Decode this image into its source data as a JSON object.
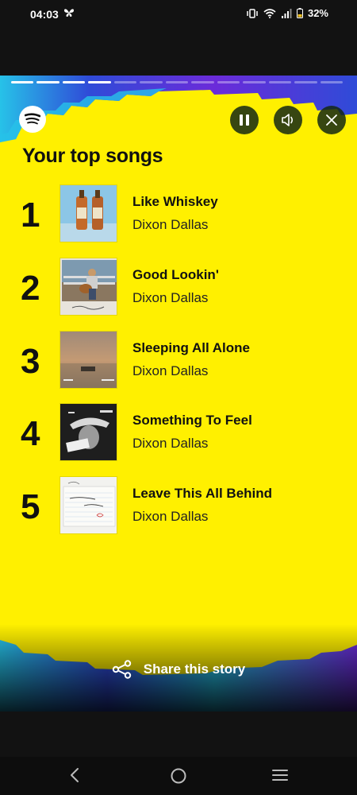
{
  "status_bar": {
    "time": "04:03",
    "battery": "32%"
  },
  "story": {
    "progress_total": 13,
    "progress_done": 4,
    "title": "Your top songs",
    "share_label": "Share this story",
    "colors": {
      "background": "#fff000",
      "accent_blue": "#2f4bd8",
      "accent_purple": "#6b2bd9",
      "accent_cyan": "#27c2e8"
    }
  },
  "controls": {
    "pause_icon": "pause-icon",
    "sound_icon": "speaker-icon",
    "close_icon": "close-icon"
  },
  "songs": [
    {
      "rank": "1",
      "title": "Like Whiskey",
      "artist": "Dixon Dallas"
    },
    {
      "rank": "2",
      "title": "Good Lookin'",
      "artist": "Dixon Dallas"
    },
    {
      "rank": "3",
      "title": "Sleeping All Alone",
      "artist": "Dixon Dallas"
    },
    {
      "rank": "4",
      "title": "Something To Feel",
      "artist": "Dixon Dallas"
    },
    {
      "rank": "5",
      "title": "Leave This All Behind",
      "artist": "Dixon Dallas"
    }
  ],
  "nav": {
    "back_icon": "back-icon",
    "home_icon": "home-icon",
    "recents_icon": "recents-icon"
  }
}
